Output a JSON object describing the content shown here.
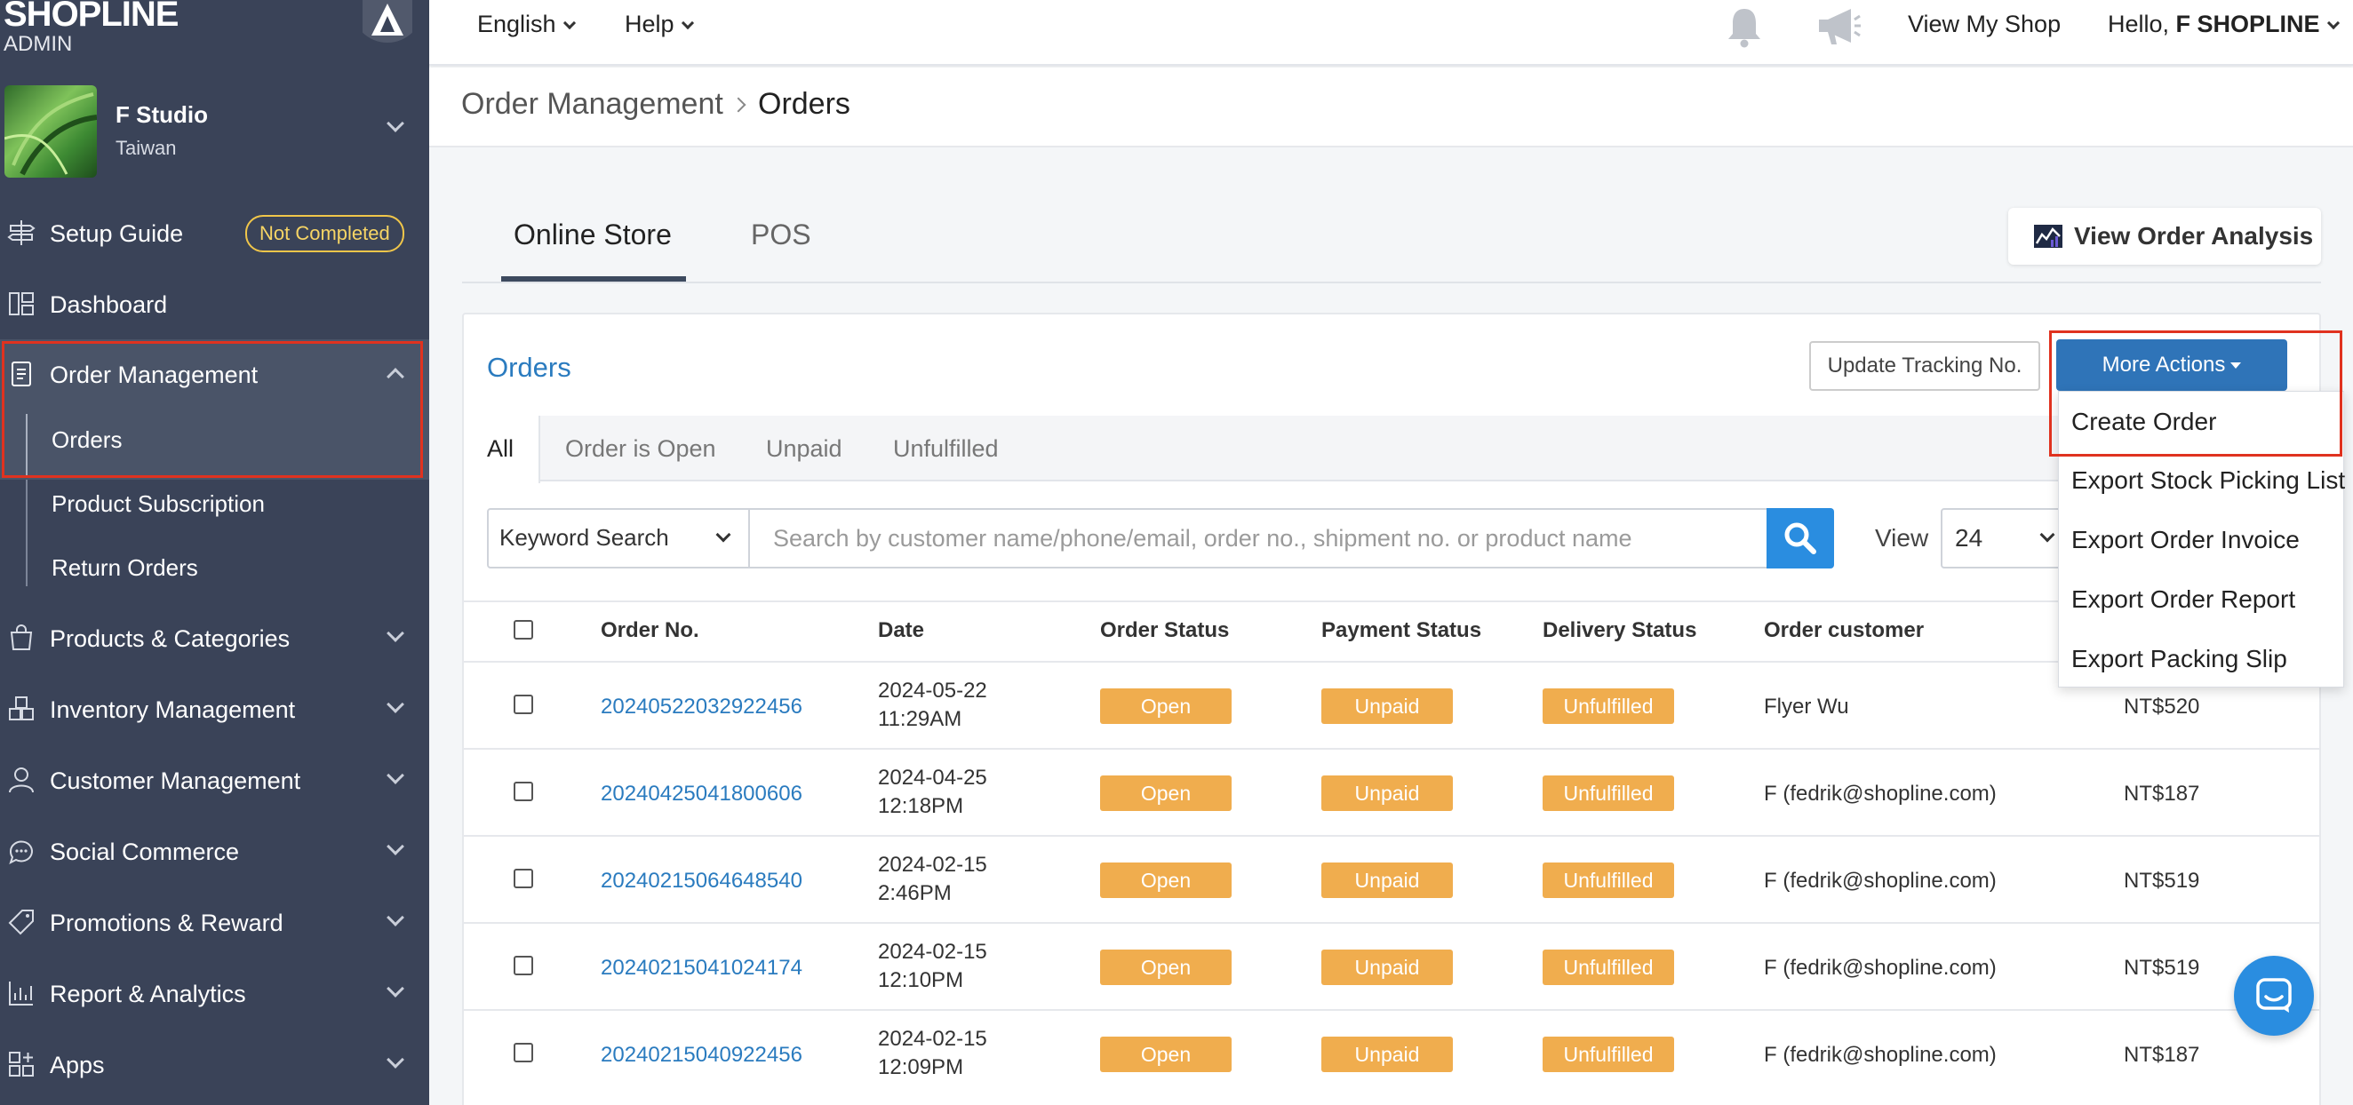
{
  "brand": {
    "logo": "SHOPLINE",
    "sub": "ADMIN"
  },
  "store": {
    "name": "F Studio",
    "region": "Taiwan"
  },
  "sidebar": {
    "items": [
      {
        "label": "Setup Guide",
        "badge": "Not Completed"
      },
      {
        "label": "Dashboard"
      },
      {
        "label": "Order Management"
      },
      {
        "label": "Products & Categories"
      },
      {
        "label": "Inventory Management"
      },
      {
        "label": "Customer Management"
      },
      {
        "label": "Social Commerce"
      },
      {
        "label": "Promotions & Reward"
      },
      {
        "label": "Report & Analytics"
      },
      {
        "label": "Apps"
      }
    ],
    "sub_items": [
      {
        "label": "Orders"
      },
      {
        "label": "Product Subscription"
      },
      {
        "label": "Return Orders"
      }
    ]
  },
  "topbar": {
    "language": "English",
    "help": "Help",
    "view_shop": "View My Shop",
    "greeting": "Hello,",
    "user": "F SHOPLINE"
  },
  "breadcrumb": {
    "parent": "Order Management",
    "current": "Orders"
  },
  "tabs": [
    {
      "label": "Online Store"
    },
    {
      "label": "POS"
    }
  ],
  "analysis_button": "View Order Analysis",
  "card": {
    "title": "Orders",
    "update_button": "Update Tracking No.",
    "more_button": "More Actions",
    "more_menu": [
      "Create Order",
      "Export Stock Picking List",
      "Export Order Invoice",
      "Export Order Report",
      "Export Packing Slip"
    ],
    "status_tabs": [
      "All",
      "Order is Open",
      "Unpaid",
      "Unfulfilled"
    ],
    "search": {
      "mode": "Keyword Search",
      "placeholder": "Search by customer name/phone/email, order no., shipment no. or product name"
    },
    "view_label": "View",
    "view_value": "24"
  },
  "table": {
    "headers": [
      "Order No.",
      "Date",
      "Order Status",
      "Payment Status",
      "Delivery Status",
      "Order customer"
    ],
    "rows": [
      {
        "order_no": "20240522032922456",
        "date": "2024-05-22",
        "time": "11:29AM",
        "order_status": "Open",
        "payment_status": "Unpaid",
        "delivery_status": "Unfulfilled",
        "customer": "Flyer Wu",
        "amount": "NT$520"
      },
      {
        "order_no": "20240425041800606",
        "date": "2024-04-25",
        "time": "12:18PM",
        "order_status": "Open",
        "payment_status": "Unpaid",
        "delivery_status": "Unfulfilled",
        "customer": "F (fedrik@shopline.com)",
        "amount": "NT$187"
      },
      {
        "order_no": "20240215064648540",
        "date": "2024-02-15",
        "time": "2:46PM",
        "order_status": "Open",
        "payment_status": "Unpaid",
        "delivery_status": "Unfulfilled",
        "customer": "F (fedrik@shopline.com)",
        "amount": "NT$519"
      },
      {
        "order_no": "20240215041024174",
        "date": "2024-02-15",
        "time": "12:10PM",
        "order_status": "Open",
        "payment_status": "Unpaid",
        "delivery_status": "Unfulfilled",
        "customer": "F (fedrik@shopline.com)",
        "amount": "NT$519"
      },
      {
        "order_no": "20240215040922456",
        "date": "2024-02-15",
        "time": "12:09PM",
        "order_status": "Open",
        "payment_status": "Unpaid",
        "delivery_status": "Unfulfilled",
        "customer": "F (fedrik@shopline.com)",
        "amount": "NT$187"
      }
    ]
  },
  "colors": {
    "sidebar_bg": "#3a4358",
    "accent_blue": "#2a7bbf",
    "button_blue": "#2f74b8",
    "status_orange": "#f0ad4e",
    "highlight_red": "#e0321f"
  }
}
